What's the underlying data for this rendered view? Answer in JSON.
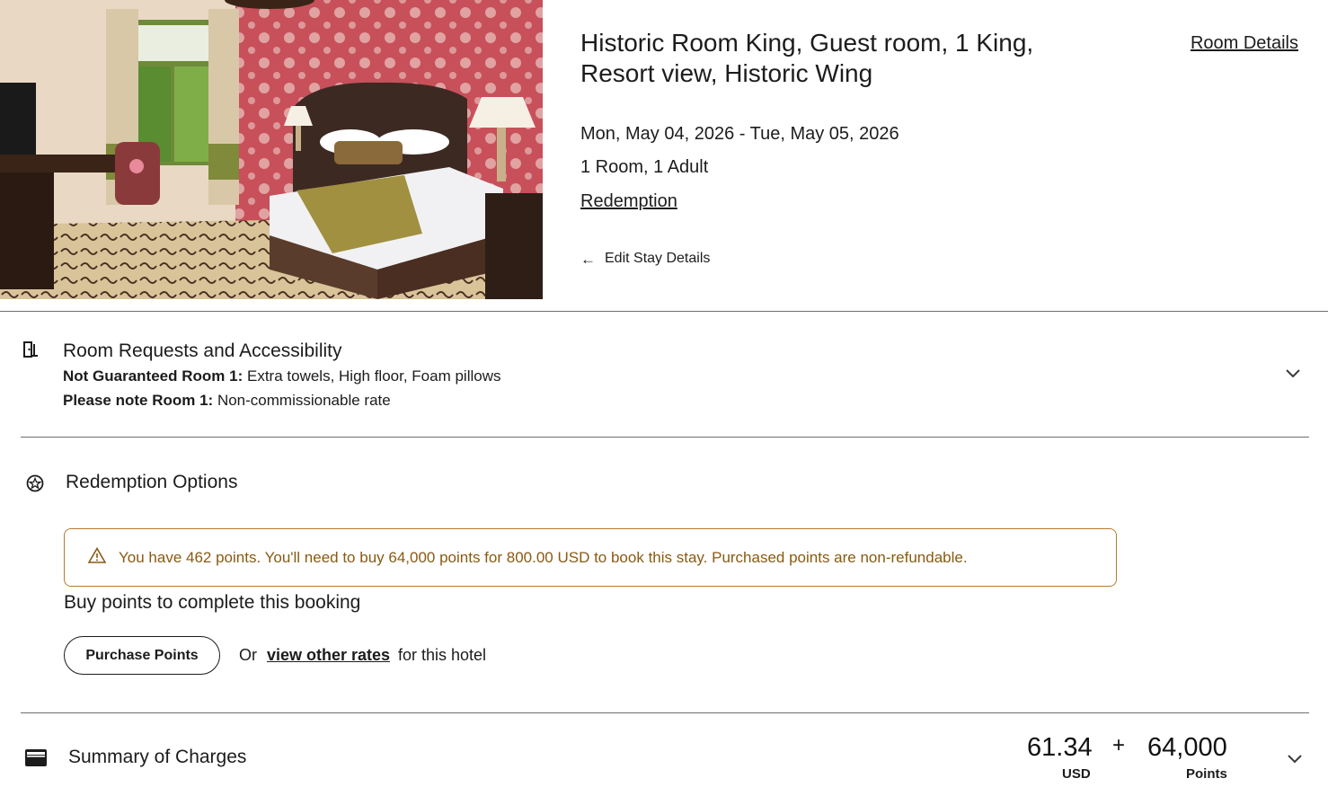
{
  "header": {
    "room_title": "Historic Room King, Guest room, 1 King, Resort view, Historic Wing",
    "room_details_link": "Room Details",
    "dates": "Mon, May 04, 2026 - Tue, May 05, 2026",
    "guests": "1 Room, 1 Adult",
    "rate_link": "Redemption",
    "edit_stay": "Edit Stay Details"
  },
  "room_requests": {
    "title": "Room Requests and Accessibility",
    "lines": [
      {
        "label": "Not Guaranteed Room 1:",
        "value": "Extra towels, High floor, Foam pillows"
      },
      {
        "label": "Please note Room 1:",
        "value": "Non-commissionable rate"
      }
    ]
  },
  "redemption": {
    "title": "Redemption Options",
    "alert": "You have 462 points. You'll need to buy 64,000 points for 800.00 USD to book this stay. Purchased points are non-refundable.",
    "buy_text": "Buy points to complete this booking",
    "purchase_button": "Purchase Points",
    "or_text": "Or",
    "other_rates_link": "view other rates",
    "for_hotel_text": "for this hotel"
  },
  "summary": {
    "title": "Summary of Charges",
    "cash_amount": "61.34",
    "cash_unit": "USD",
    "plus": "+",
    "points_amount": "64,000",
    "points_unit": "Points"
  },
  "icons": {
    "back": "arrow-left-icon",
    "requests": "door-icon",
    "redemption": "star-badge-icon",
    "warning": "warning-triangle-icon",
    "summary": "wallet-icon",
    "expand": "chevron-down-icon"
  },
  "colors": {
    "alert_border": "#b57a2e",
    "alert_text": "#8a5a12",
    "divider": "#6f6f6f"
  }
}
